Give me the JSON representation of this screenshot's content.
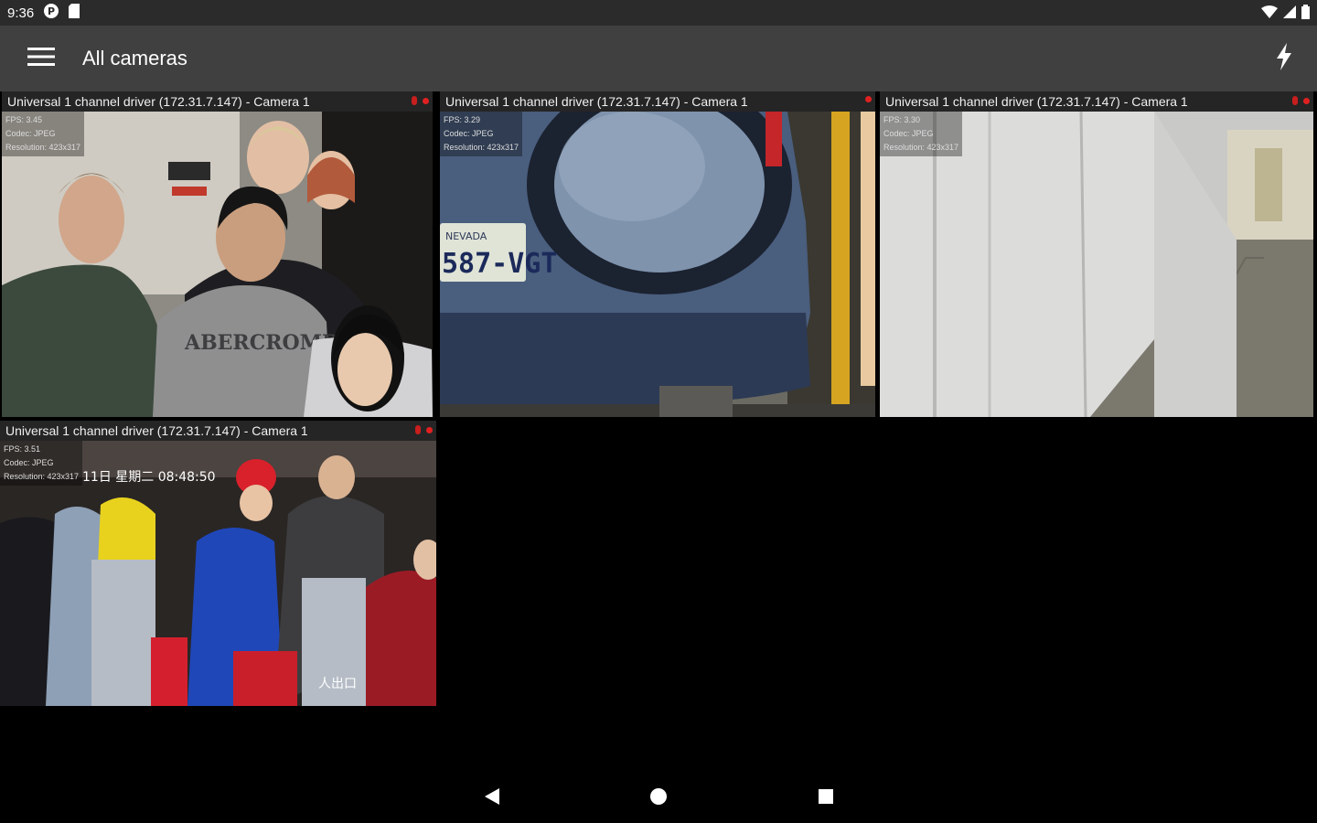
{
  "status_bar": {
    "time": "9:36",
    "icons": [
      "notification-icon",
      "sd-card-icon",
      "wifi-icon",
      "signal-icon",
      "battery-icon"
    ]
  },
  "app_bar": {
    "title": "All cameras",
    "menu_icon": "hamburger-menu-icon",
    "action_icon": "lightning-icon"
  },
  "cameras": [
    {
      "name": "Universal 1 channel driver (172.31.7.147) - Camera 1",
      "fps": "FPS: 3.45",
      "codec": "Codec: JPEG",
      "resolution": "Resolution: 423x317",
      "scene": "people-in-office"
    },
    {
      "name": "Universal 1 channel driver (172.31.7.147) - Camera 1",
      "fps": "FPS: 3.29",
      "codec": "Codec: JPEG",
      "resolution": "Resolution: 423x317",
      "scene": "car-license-plate",
      "plate": "587-VGT",
      "plate_state": "NEVADA"
    },
    {
      "name": "Universal 1 channel driver (172.31.7.147) - Camera 1",
      "fps": "FPS: 3.30",
      "codec": "Codec: JPEG",
      "resolution": "Resolution: 423x317",
      "scene": "hallway"
    },
    {
      "name": "Universal 1 channel driver (172.31.7.147) - Camera 1",
      "fps": "FPS: 3.51",
      "codec": "Codec: JPEG",
      "resolution": "Resolution: 423x317",
      "overlay": "11日 星期二 08:48:50",
      "scene": "crowd-at-turnstiles"
    }
  ],
  "colors": {
    "status_bar": "#2b2b2b",
    "app_bar": "#404040",
    "background": "#000000",
    "recording_indicator": "#e02020"
  },
  "nav_bar": {
    "icons": [
      "back-icon",
      "home-icon",
      "recents-icon"
    ]
  }
}
